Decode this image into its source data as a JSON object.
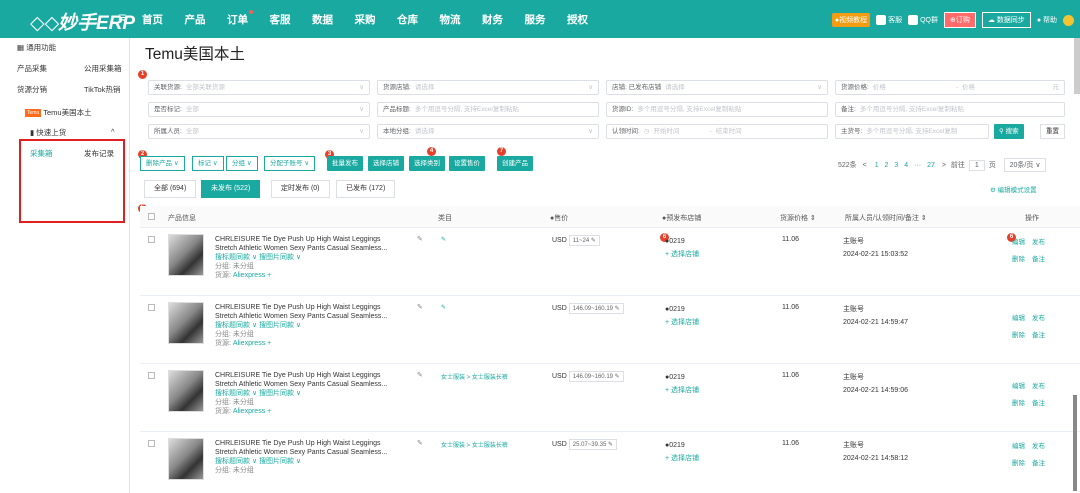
{
  "app": {
    "logo": "妙手ERP"
  },
  "nav": [
    "首页",
    "产品",
    "订单",
    "客服",
    "数据",
    "采购",
    "仓库",
    "物流",
    "财务",
    "服务",
    "授权"
  ],
  "topright": {
    "video": "●视频教程",
    "service": "客服",
    "qq": "QQ群",
    "order": "订购",
    "sync": "数据同步",
    "help": "帮助"
  },
  "sidebar": {
    "common": "通用功能",
    "items": [
      [
        "产品采集",
        "公用采集箱"
      ],
      [
        "货源分销",
        "TikTok热销"
      ]
    ],
    "temu": "Temu美国本土",
    "temu_tag": "Temu",
    "quick": "快速上货",
    "sub": [
      "采集箱",
      "发布记录"
    ]
  },
  "page": {
    "title": "Temu美国本土"
  },
  "filters": {
    "row1": [
      {
        "label": "关联货源:",
        "ph": "全部关联货源"
      },
      {
        "label": "货源店铺:",
        "ph": "请选择"
      },
      {
        "label": "店铺: 已发布店铺",
        "ph": "请选择"
      },
      {
        "label": "货源价格:",
        "ph": "价格",
        "ph2": "价格",
        "unit": "元"
      }
    ],
    "row2": [
      {
        "label": "是否标记:",
        "ph": "全部"
      },
      {
        "label": "产品标题:",
        "ph": "多个用逗号分隔, 支持Excel复制粘贴"
      },
      {
        "label": "货源ID:",
        "ph": "多个用逗号分隔, 支持Excel复制粘贴"
      },
      {
        "label": "备注:",
        "ph": "多个用逗号分隔, 支持Excel复制粘贴"
      }
    ],
    "row3": [
      {
        "label": "所属人员:",
        "ph": "全部"
      },
      {
        "label": "本地分组:",
        "ph": "请选择"
      },
      {
        "label": "认领时间:",
        "ph": "开始时间",
        "ph2": "结束时间"
      },
      {
        "label": "主货号:",
        "ph": "多个用逗号分隔, 支持Excel复制"
      }
    ],
    "search": "搜索",
    "reset": "重置"
  },
  "actions": {
    "delete": "删除产品",
    "mark": "标记",
    "group": "分组",
    "assign": "分配子账号",
    "batch": "批量发布",
    "store": "选择店铺",
    "category": "选择类别",
    "price": "设置售价",
    "create": "创建产品"
  },
  "pagination": {
    "total": "522条",
    "pages": [
      "1",
      "2",
      "3",
      "4",
      "···",
      "27"
    ],
    "goto": "前往",
    "page": "1",
    "unit": "页",
    "size": "20条/页"
  },
  "tabs": [
    {
      "label": "全部 (694)"
    },
    {
      "label": "未发布 (522)"
    },
    {
      "label": "定时发布 (0)"
    },
    {
      "label": "已发布 (172)"
    }
  ],
  "edit_mode": "编辑模式设置",
  "table": {
    "headers": [
      "产品信息",
      "类目",
      "售价",
      "预发布店铺",
      "货源价格",
      "所属人员/认领时间/备注",
      "操作"
    ]
  },
  "markers": [
    "1",
    "2",
    "3",
    "4",
    "5",
    "6",
    "6",
    "7"
  ],
  "rows": [
    {
      "title1": "CHRLEISURE Tie Dye Push Up High Waist Leggings",
      "title2": "Stretch Athletic Women Sexy Pants Casual Seamless...",
      "search1": "搜标题同款",
      "search2": "搜图片同款",
      "group": "分组: 未分组",
      "source_label": "货源:",
      "source": "Aliexpress",
      "cat": "",
      "cur": "USD",
      "price": "11~24",
      "shop": "0219",
      "add_shop": "+ 选择店铺",
      "src_price": "11.06",
      "account": "主账号",
      "date": "2024-02-21 15:03:52",
      "ops": [
        "编辑",
        "发布",
        "删除",
        "备注"
      ]
    },
    {
      "title1": "CHRLEISURE Tie Dye Push Up High Waist Leggings",
      "title2": "Stretch Athletic Women Sexy Pants Casual Seamless...",
      "search1": "搜标题同款",
      "search2": "搜图片同款",
      "group": "分组: 未分组",
      "source_label": "货源:",
      "source": "Aliexpress",
      "cat": "",
      "cur": "USD",
      "price": "146.09~160.19",
      "shop": "0219",
      "add_shop": "+ 选择店铺",
      "src_price": "11.06",
      "account": "主账号",
      "date": "2024-02-21 14:59:47",
      "ops": [
        "编辑",
        "发布",
        "删除",
        "备注"
      ]
    },
    {
      "title1": "CHRLEISURE Tie Dye Push Up High Waist Leggings",
      "title2": "Stretch Athletic Women Sexy Pants Casual Seamless...",
      "search1": "搜标题同款",
      "search2": "搜图片同款",
      "group": "分组: 未分组",
      "source_label": "货源:",
      "source": "Aliexpress",
      "cat": "女士服装 > 女士服装长裤",
      "cur": "USD",
      "price": "146.09~160.19",
      "shop": "0219",
      "add_shop": "+ 选择店铺",
      "src_price": "11.06",
      "account": "主账号",
      "date": "2024-02-21 14:59:06",
      "ops": [
        "编辑",
        "发布",
        "删除",
        "备注"
      ]
    },
    {
      "title1": "CHRLEISURE Tie Dye Push Up High Waist Leggings",
      "title2": "Stretch Athletic Women Sexy Pants Casual Seamless...",
      "search1": "搜标题同款",
      "search2": "搜图片同款",
      "group": "分组: 未分组",
      "source_label": "货源:",
      "source": "Aliexpress",
      "cat": "女士服装 > 女士服装长裤",
      "cur": "USD",
      "price": "25.07~39.35",
      "shop": "0219",
      "add_shop": "+ 选择店铺",
      "src_price": "11.06",
      "account": "主账号",
      "date": "2024-02-21 14:58:12",
      "ops": [
        "编辑",
        "发布",
        "删除",
        "备注"
      ]
    }
  ]
}
